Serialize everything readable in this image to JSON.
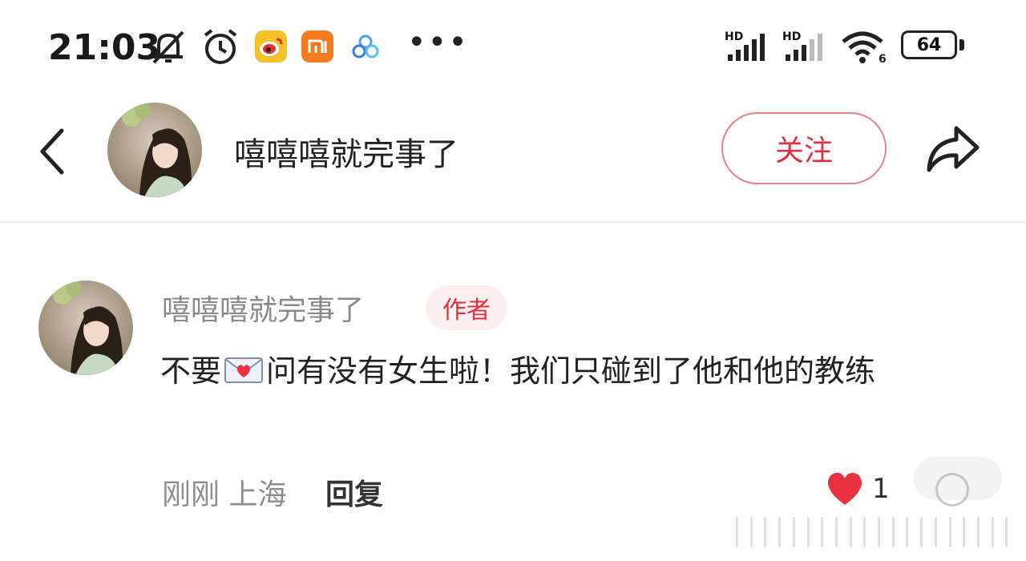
{
  "status_bar": {
    "time": "21:03",
    "battery": "64",
    "hd1": "HD",
    "hd2": "HD",
    "more": "•••",
    "icons": [
      "mute-bell-icon",
      "alarm-icon",
      "weibo-icon",
      "mi-icon",
      "baidu-cloud-icon",
      "signal-icon",
      "wifi-icon",
      "battery-icon"
    ]
  },
  "header": {
    "title": "嘻嘻嘻就完事了",
    "follow_label": "关注",
    "icons": [
      "back-arrow-icon",
      "share-icon"
    ]
  },
  "comment": {
    "author": "嘻嘻嘻就完事了",
    "author_tag": "作者",
    "text_before": "不要",
    "text_after": "问有没有女生啦！我们只碰到了他和他的教练",
    "emoji": "love-letter-icon",
    "meta": "刚刚 上海",
    "reply_label": "回复",
    "likes": "1"
  },
  "colors": {
    "accent": "#e03142",
    "like": "#e8323f",
    "muted_text": "#8a8a8a",
    "author_tag_bg": "#fdeff0"
  }
}
